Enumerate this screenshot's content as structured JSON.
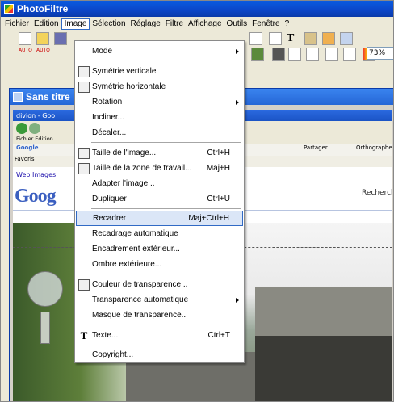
{
  "app": {
    "title": "PhotoFiltre"
  },
  "menubar": {
    "items": [
      "Fichier",
      "Edition",
      "Image",
      "Sélection",
      "Réglage",
      "Filtre",
      "Affichage",
      "Outils",
      "Fenêtre",
      "?"
    ],
    "active": "Image"
  },
  "toolbar": {
    "zoom": "73%",
    "auto1": "AUTO",
    "auto2": "AUTO"
  },
  "document": {
    "title": "Sans titre"
  },
  "browser": {
    "title": "divion - Goo",
    "menu": "Fichier   Edition",
    "google_label": "Google",
    "google_partager": "Partager",
    "google_ortho": "Orthographe",
    "favoris": "Favoris",
    "top_links": "Web  Images",
    "logo": "Goog",
    "recherche": "Recherche"
  },
  "image_menu": {
    "items": [
      {
        "label": "Mode",
        "shortcut": "",
        "submenu": true,
        "icon": ""
      },
      {
        "label": "Symétrie verticale",
        "shortcut": "",
        "submenu": false,
        "icon": "flip-vertical-icon"
      },
      {
        "label": "Symétrie horizontale",
        "shortcut": "",
        "submenu": false,
        "icon": "flip-horizontal-icon"
      },
      {
        "label": "Rotation",
        "shortcut": "",
        "submenu": true,
        "icon": ""
      },
      {
        "label": "Incliner...",
        "shortcut": "",
        "submenu": false,
        "icon": ""
      },
      {
        "label": "Décaler...",
        "shortcut": "",
        "submenu": false,
        "icon": ""
      },
      {
        "label": "Taille de l'image...",
        "shortcut": "Ctrl+H",
        "submenu": false,
        "icon": "image-size-icon"
      },
      {
        "label": "Taille de la zone de travail...",
        "shortcut": "Maj+H",
        "submenu": false,
        "icon": "canvas-size-icon"
      },
      {
        "label": "Adapter l'image...",
        "shortcut": "",
        "submenu": false,
        "icon": ""
      },
      {
        "label": "Dupliquer",
        "shortcut": "Ctrl+U",
        "submenu": false,
        "icon": ""
      },
      {
        "label": "Recadrer",
        "shortcut": "Maj+Ctrl+H",
        "submenu": false,
        "icon": "",
        "highlighted": true
      },
      {
        "label": "Recadrage automatique",
        "shortcut": "",
        "submenu": false,
        "icon": ""
      },
      {
        "label": "Encadrement extérieur...",
        "shortcut": "",
        "submenu": false,
        "icon": ""
      },
      {
        "label": "Ombre extérieure...",
        "shortcut": "",
        "submenu": false,
        "icon": ""
      },
      {
        "label": "Couleur de transparence...",
        "shortcut": "",
        "submenu": false,
        "icon": "transparency-color-icon"
      },
      {
        "label": "Transparence automatique",
        "shortcut": "",
        "submenu": true,
        "icon": ""
      },
      {
        "label": "Masque de transparence...",
        "shortcut": "",
        "submenu": false,
        "icon": ""
      },
      {
        "label": "Texte...",
        "shortcut": "Ctrl+T",
        "submenu": false,
        "icon": "text-icon"
      },
      {
        "label": "Copyright...",
        "shortcut": "",
        "submenu": false,
        "icon": ""
      }
    ]
  }
}
